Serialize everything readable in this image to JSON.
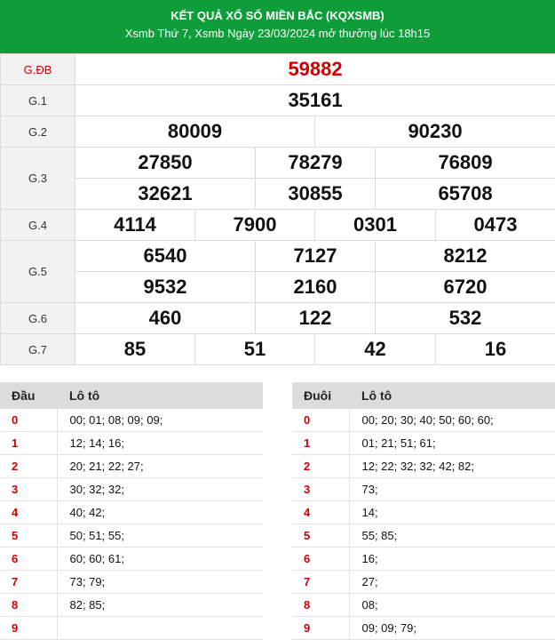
{
  "header": {
    "title": "KẾT QUẢ XỔ SỐ MIỀN BẮC (KQXSMB)",
    "subtitle": "Xsmb Thứ 7, Xsmb Ngày 23/03/2024 mở thưởng lúc 18h15"
  },
  "prizes": {
    "db": {
      "label": "G.ĐB",
      "numbers": [
        "59882"
      ]
    },
    "g1": {
      "label": "G.1",
      "numbers": [
        "35161"
      ]
    },
    "g2": {
      "label": "G.2",
      "numbers": [
        "80009",
        "90230"
      ]
    },
    "g3": {
      "label": "G.3",
      "numbers": [
        "27850",
        "78279",
        "76809",
        "32621",
        "30855",
        "65708"
      ]
    },
    "g4": {
      "label": "G.4",
      "numbers": [
        "4114",
        "7900",
        "0301",
        "0473"
      ]
    },
    "g5": {
      "label": "G.5",
      "numbers": [
        "6540",
        "7127",
        "8212",
        "9532",
        "2160",
        "6720"
      ]
    },
    "g6": {
      "label": "G.6",
      "numbers": [
        "460",
        "122",
        "532"
      ]
    },
    "g7": {
      "label": "G.7",
      "numbers": [
        "85",
        "51",
        "42",
        "16"
      ]
    }
  },
  "loto_head": {
    "col1": "Đầu",
    "col2": "Lô tô",
    "rows": [
      {
        "k": "0",
        "v": "00; 01; 08; 09; 09;"
      },
      {
        "k": "1",
        "v": "12; 14; 16;"
      },
      {
        "k": "2",
        "v": "20; 21; 22; 27;"
      },
      {
        "k": "3",
        "v": "30; 32; 32;"
      },
      {
        "k": "4",
        "v": "40; 42;"
      },
      {
        "k": "5",
        "v": "50; 51; 55;"
      },
      {
        "k": "6",
        "v": "60; 60; 61;"
      },
      {
        "k": "7",
        "v": "73; 79;"
      },
      {
        "k": "8",
        "v": "82; 85;"
      },
      {
        "k": "9",
        "v": ""
      }
    ]
  },
  "loto_tail": {
    "col1": "Đuôi",
    "col2": "Lô tô",
    "rows": [
      {
        "k": "0",
        "v": "00; 20; 30; 40; 50; 60; 60;"
      },
      {
        "k": "1",
        "v": "01; 21; 51; 61;"
      },
      {
        "k": "2",
        "v": "12; 22; 32; 32; 42; 82;"
      },
      {
        "k": "3",
        "v": "73;"
      },
      {
        "k": "4",
        "v": "14;"
      },
      {
        "k": "5",
        "v": "55; 85;"
      },
      {
        "k": "6",
        "v": "16;"
      },
      {
        "k": "7",
        "v": "27;"
      },
      {
        "k": "8",
        "v": "08;"
      },
      {
        "k": "9",
        "v": "09; 09; 79;"
      }
    ]
  },
  "colors": {
    "header_bg": "#0f9d3a",
    "accent_red": "#d10000",
    "label_bg": "#f2f2f2"
  }
}
